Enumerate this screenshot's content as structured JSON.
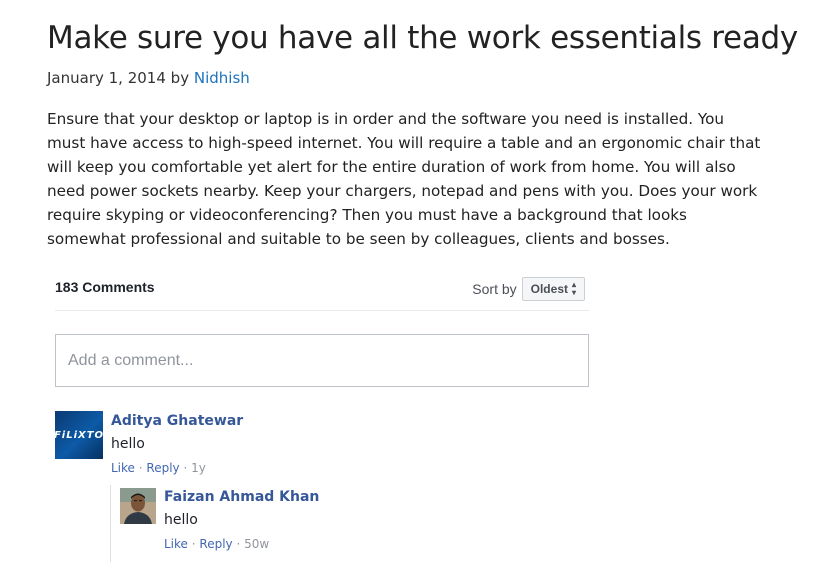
{
  "post": {
    "title": "Make sure you have all the work essentials ready",
    "date": "January 1, 2014",
    "by": "by",
    "author": "Nidhish",
    "body": "Ensure that your desktop or laptop is in order and the software you need is installed. You must have access to high-speed internet. You will require a table and an ergonomic chair that will keep you comfortable yet alert for the entire duration of work from home. You will also need power sockets nearby. Keep your chargers, notepad and pens with you. Does your work require skyping or videoconferencing? Then you must have a background that looks somewhat professional and suitable to be seen by colleagues, clients and bosses."
  },
  "comments_plugin": {
    "count_label": "183 Comments",
    "sort_label": "Sort by",
    "sort_value": "Oldest",
    "input_placeholder": "Add a comment...",
    "like": "Like",
    "reply": "Reply",
    "sep": "·",
    "comments": [
      {
        "author": "Aditya Ghatewar",
        "avatar_text": "FiLiXTO",
        "text": "hello",
        "age": "1y"
      },
      {
        "author": "Faizan Ahmad Khan",
        "text": "hello",
        "age": "50w"
      }
    ]
  }
}
